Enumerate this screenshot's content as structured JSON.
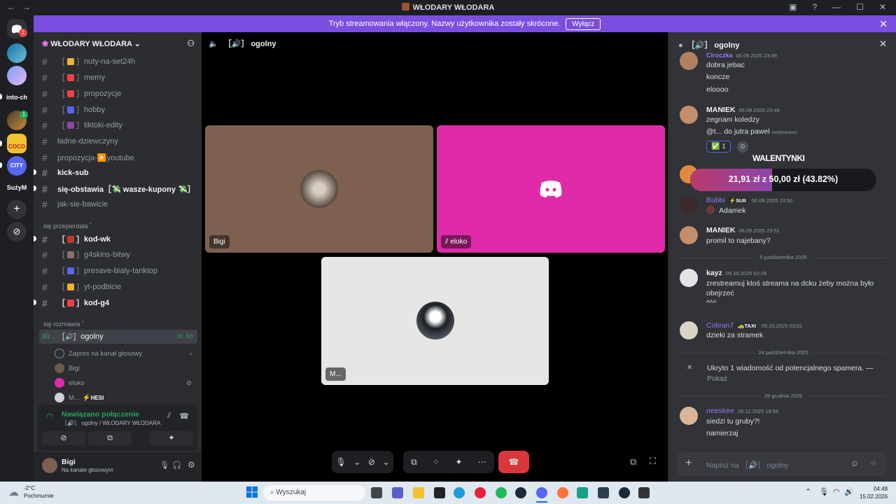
{
  "window": {
    "title": "WŁODARY WŁODARA",
    "back": "←",
    "forward": "→"
  },
  "banner": {
    "text": "Tryb streamowania włączony. Nazwy użytkownika zostały skrócone.",
    "button": "Wyłącz"
  },
  "servers": {
    "badge_dm": "1",
    "badge_folder": "1",
    "label_intotech": "into‑ch",
    "label_coco": "COCO",
    "label_city": "CITY",
    "label_suzym": "SużyM"
  },
  "sidebar": {
    "server_name": "WŁODARY WŁODARA",
    "channels": [
      {
        "name": "nuty-na-set24h",
        "emoji_color": "#f0b232"
      },
      {
        "name": "memy",
        "emoji_color": "#f23f43"
      },
      {
        "name": "propozycje",
        "emoji_color": "#f23f43"
      },
      {
        "name": "hobby",
        "emoji_color": "#5865f2"
      },
      {
        "name": "tiktoki-edity",
        "emoji_color": "#8e44ad"
      },
      {
        "name": "ładne-dziewczyny"
      },
      {
        "name": "propozycja-▶️youtube"
      },
      {
        "name": "kick-sub"
      },
      {
        "name": "się-obstawia［💸 wasze-kupony 💸］"
      },
      {
        "name": "jak-sie-bawicie"
      }
    ],
    "category_1": "się przepierdala ˚",
    "channels_2": [
      {
        "name": "kod-wk"
      },
      {
        "name": "g4skins-bitwy"
      },
      {
        "name": "presave-bialy-tanktop"
      },
      {
        "name": "yt-podbicie"
      },
      {
        "name": "kod-g4"
      }
    ],
    "category_2": "się rozmawia ˚",
    "voice_channel": {
      "name": "ogolny",
      "timer": "0:06"
    },
    "voice_invite": "Zaproś na kanał głosowy",
    "voice_users": [
      "Bigi",
      "eloko",
      "M..."
    ],
    "voice_user_tag": "HESI",
    "voice_panel": {
      "status": "Nawiązano połączenie",
      "channel": "［🔊］ ogolny / WŁODARY WŁODARA"
    },
    "user": {
      "name": "Bigi",
      "status": "Na kanale głosowym"
    }
  },
  "stage": {
    "channel": "［🔊］ ogolny",
    "tiles": [
      {
        "label": "Bigi",
        "color": "#7d6050"
      },
      {
        "label": "eloko",
        "color": "#e02ba8"
      },
      {
        "label": "M...",
        "color": "#e6e7e5"
      }
    ]
  },
  "chat": {
    "title": "［🔊］ ogolny",
    "messages": [
      {
        "author": "Ciroczka",
        "time": "06.09.2025 23:49",
        "lines": [
          "dobra jebac",
          "koncze",
          "eloooo"
        ]
      },
      {
        "author": "MANIEK",
        "time": "06.09.2025 23:49",
        "lines": [
          "zegnam koledzy",
          "@t... do jutra pawel",
          "(edytowane)"
        ],
        "reaction": "✅ 1"
      },
      {
        "author": "Bubbi",
        "tag": "SUII",
        "time": "06.09.2025 23:50",
        "lines": [
          "Adamek"
        ]
      },
      {
        "author": "MANIEK",
        "time": "06.09.2025 23:51",
        "lines": [
          "promil to najebany?"
        ]
      },
      {
        "author": "kayz",
        "time": "05.10.2025 02:28",
        "lines": [
          "zrestreamuj ktoś streama na dcku żeby można było",
          "obejrzeć",
          "^^^"
        ]
      },
      {
        "author": "Colean7",
        "tag": "TAXI",
        "time": "05.10.2025 03:01",
        "lines": [
          "dzieki za stramek"
        ]
      },
      {
        "author": "neeskee",
        "time": "29.12.2025 19:54",
        "lines": [
          "siedzi tu gruby?!",
          "namierzaj"
        ]
      }
    ],
    "dividers": [
      "5 października 2025",
      "24 października 2025",
      "29 grudnia 2025"
    ],
    "spam_notice": "Ukryto 1 wiadomość od potencjalnego spamera. —",
    "spam_show": "Pokaż",
    "input_placeholder": "Napisz na ［🔊］ ogolny"
  },
  "overlay": {
    "title": "WALENTYNKI",
    "text": "21,91 zł z 50,00 zł (43.82%)",
    "progress": 0.4382
  },
  "taskbar": {
    "weather_temp": "-2°C",
    "weather_desc": "Pochmurnie",
    "search": "Wyszukaj",
    "time": "04:48",
    "date": "15.02.2026"
  }
}
